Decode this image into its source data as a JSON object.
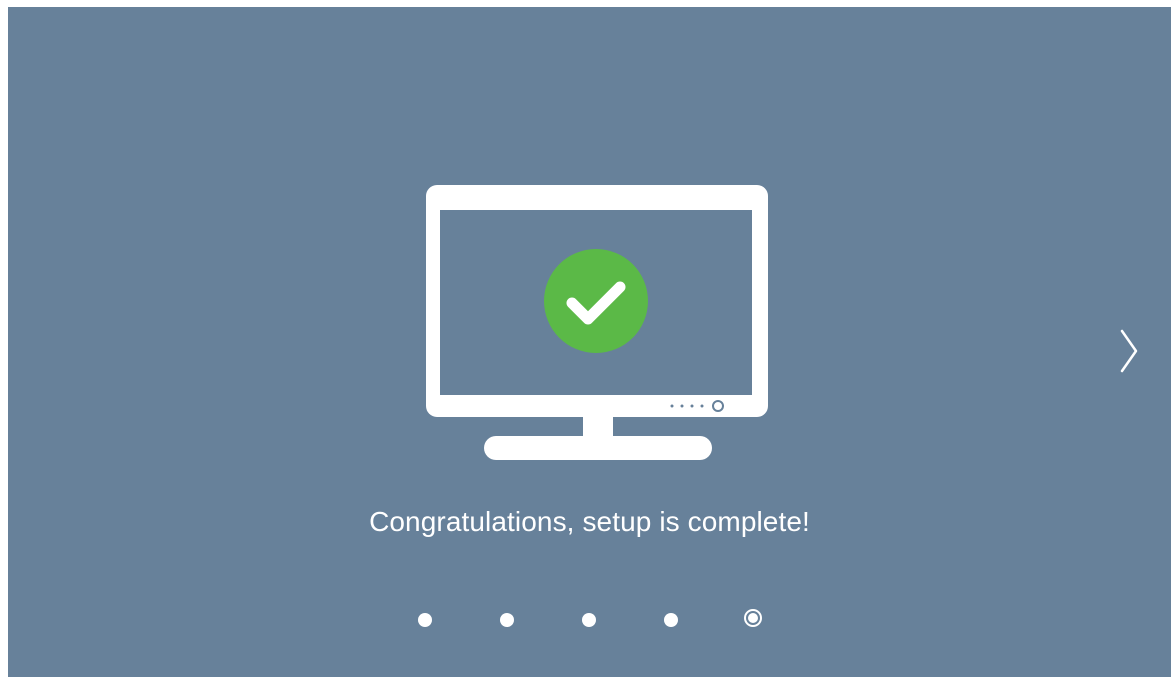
{
  "setup": {
    "message": "Congratulations, setup is complete!",
    "status_icon": "check-circle-icon",
    "next_icon": "chevron-right-icon",
    "total_steps": 5,
    "current_step": 5
  },
  "colors": {
    "background": "#67819a",
    "foreground": "#ffffff",
    "success": "#5bb947"
  }
}
